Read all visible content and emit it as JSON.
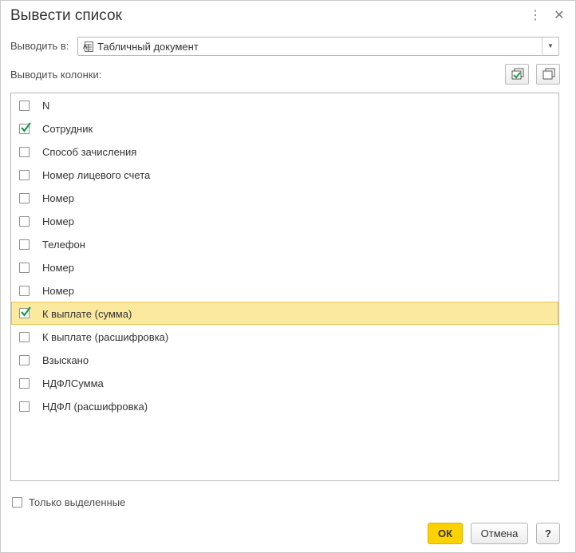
{
  "window": {
    "title": "Вывести список"
  },
  "output": {
    "label": "Выводить в:",
    "value": "Табличный документ"
  },
  "columns": {
    "label": "Выводить колонки:",
    "items": [
      {
        "label": "N",
        "checked": false,
        "selected": false
      },
      {
        "label": "Сотрудник",
        "checked": true,
        "selected": false
      },
      {
        "label": "Способ зачисления",
        "checked": false,
        "selected": false
      },
      {
        "label": "Номер лицевого счета",
        "checked": false,
        "selected": false
      },
      {
        "label": "Номер",
        "checked": false,
        "selected": false
      },
      {
        "label": "Номер",
        "checked": false,
        "selected": false
      },
      {
        "label": "Телефон",
        "checked": false,
        "selected": false
      },
      {
        "label": "Номер",
        "checked": false,
        "selected": false
      },
      {
        "label": "Номер",
        "checked": false,
        "selected": false
      },
      {
        "label": "К выплате (сумма)",
        "checked": true,
        "selected": true
      },
      {
        "label": "К выплате (расшифровка)",
        "checked": false,
        "selected": false
      },
      {
        "label": "Взыскано",
        "checked": false,
        "selected": false
      },
      {
        "label": "НДФЛСумма",
        "checked": false,
        "selected": false
      },
      {
        "label": "НДФЛ (расшифровка)",
        "checked": false,
        "selected": false
      }
    ]
  },
  "only_selected": {
    "label": "Только выделенные",
    "checked": false
  },
  "buttons": {
    "ok": "ОК",
    "cancel": "Отмена",
    "help": "?"
  },
  "icons": {
    "more": "more-vertical-icon",
    "close": "close-icon",
    "select_all": "check-all-icon",
    "uncheck_all": "uncheck-all-icon",
    "document": "spreadsheet-document-icon"
  },
  "colors": {
    "accent": "#fbd200",
    "selected_row": "#fbe9a0",
    "check": "#1a9a4a"
  }
}
